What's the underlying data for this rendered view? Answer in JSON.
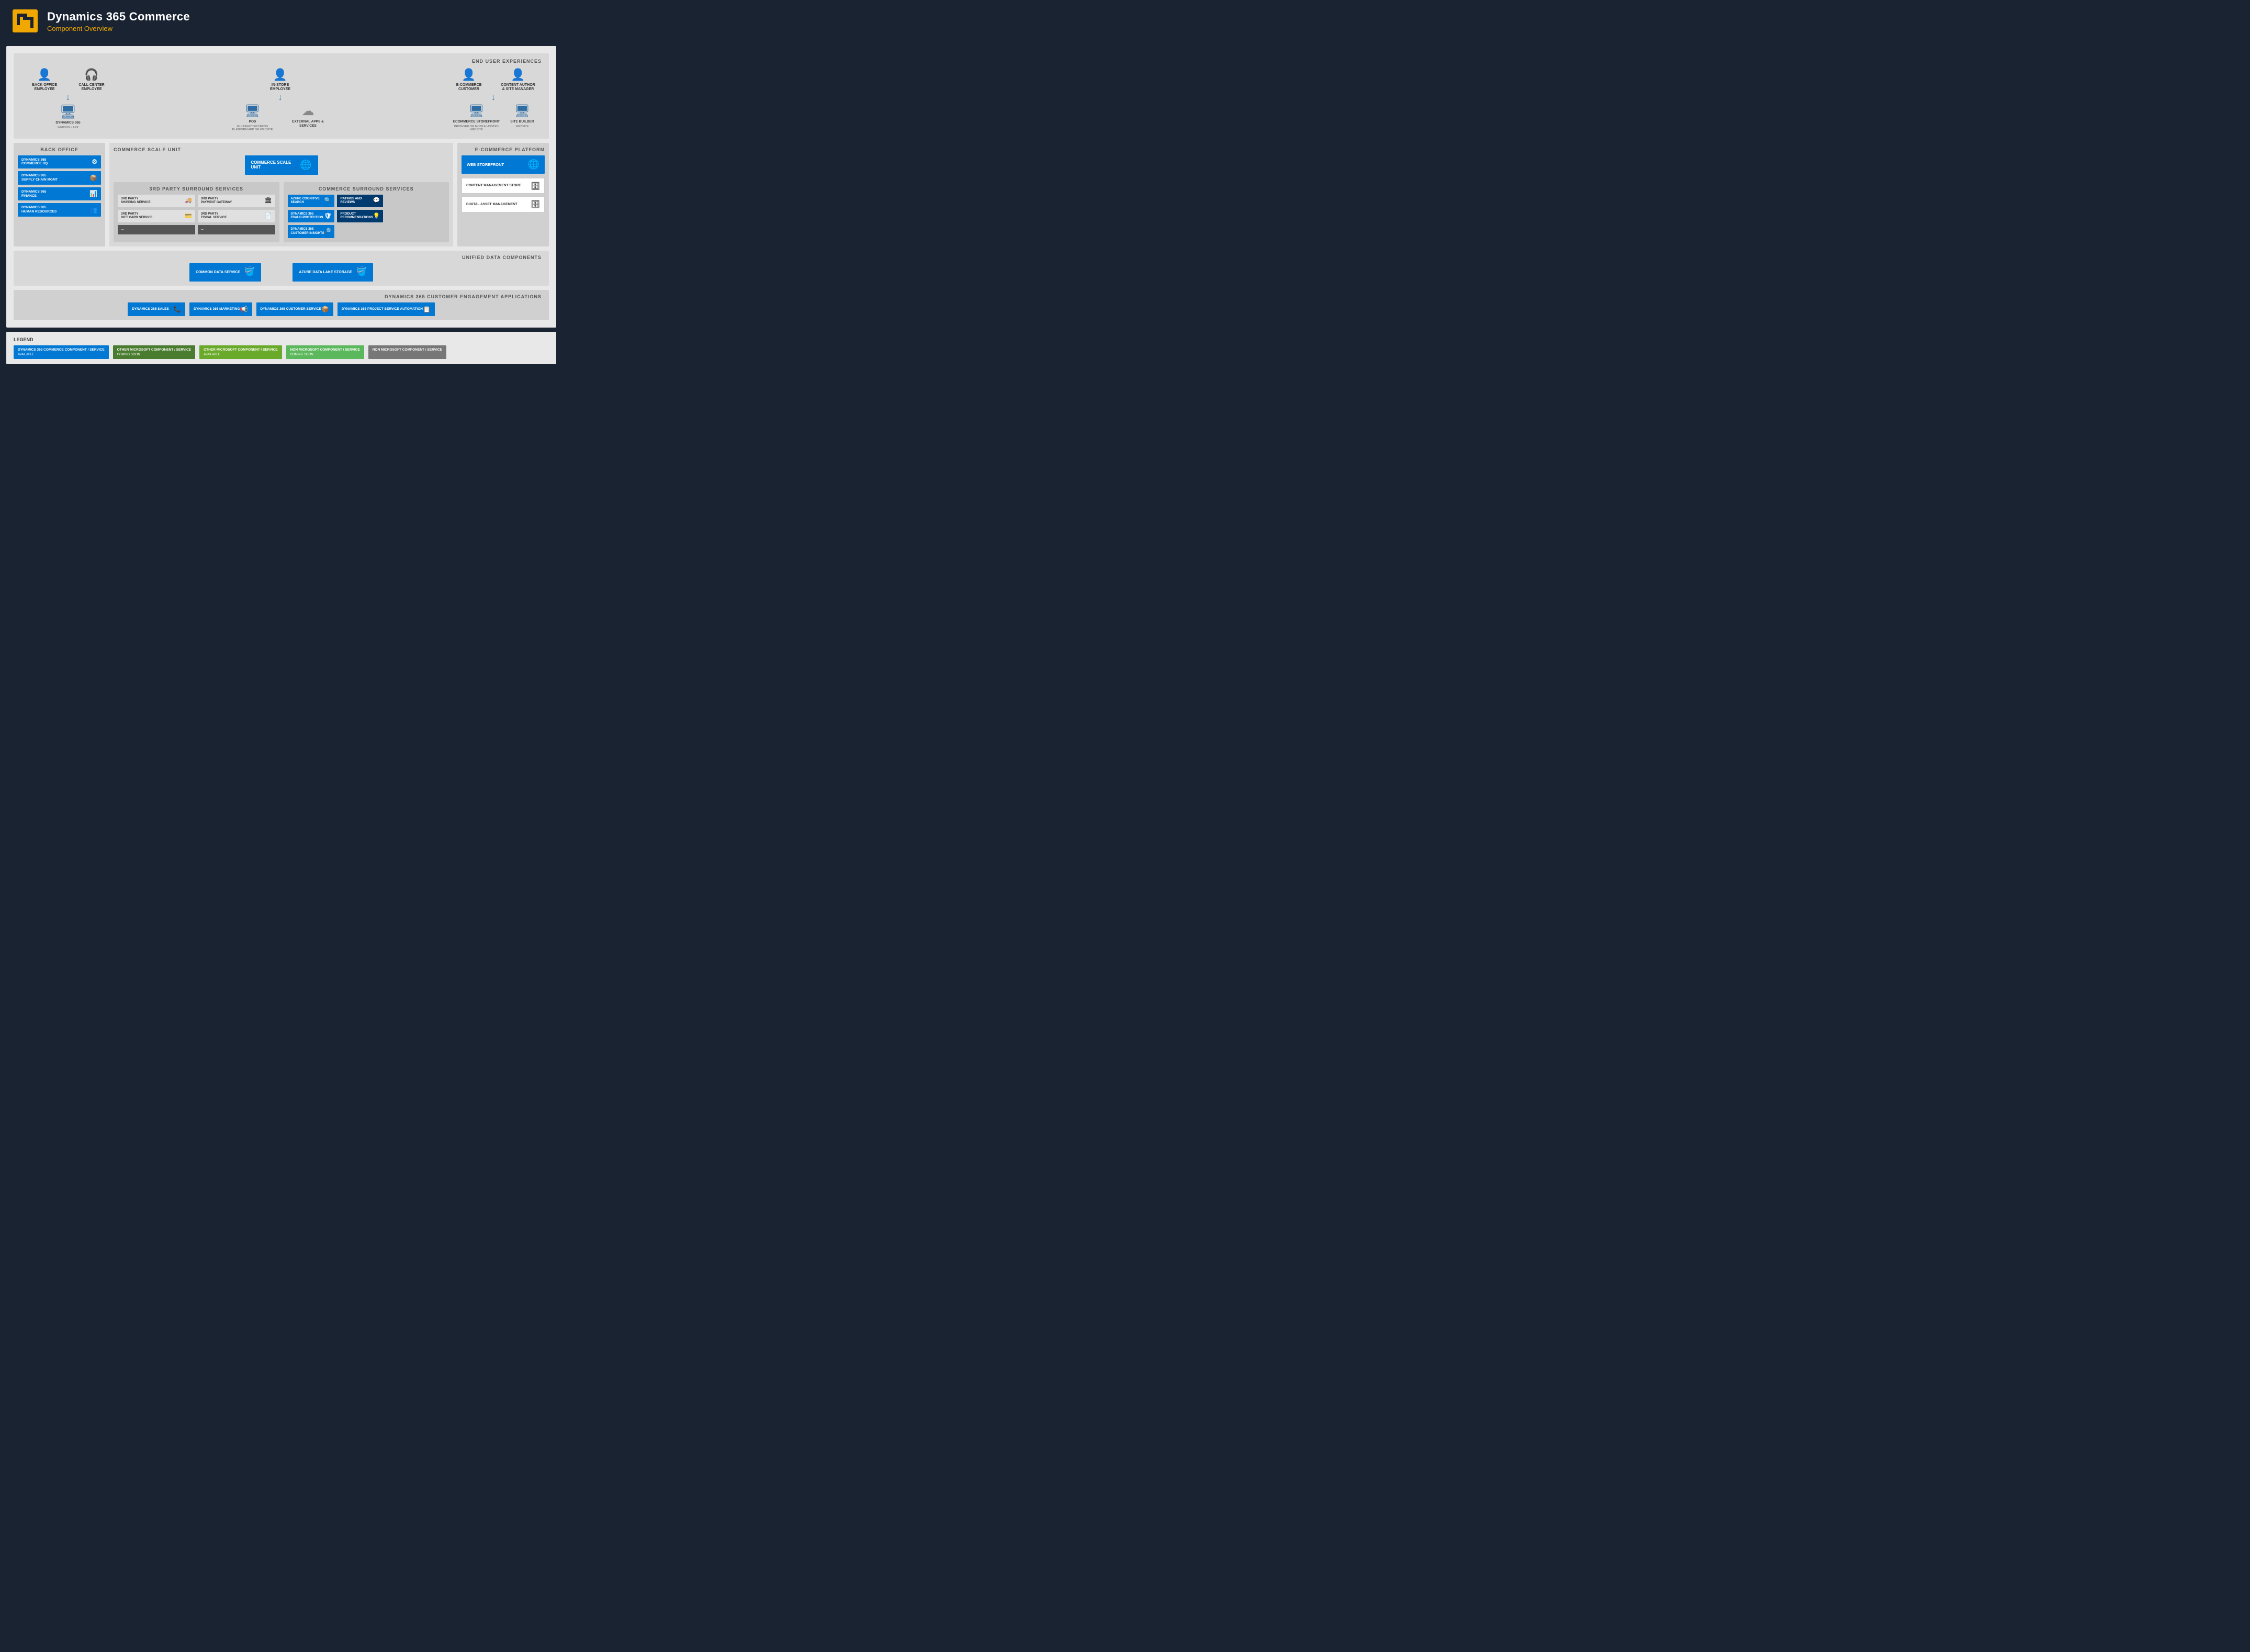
{
  "header": {
    "title": "Dynamics 365 Commerce",
    "subtitle": "Component Overview"
  },
  "endUser": {
    "sectionLabel": "END USER EXPERIENCES",
    "users": [
      {
        "name": "BACK OFFICE EMPLOYEE"
      },
      {
        "name": "CALL CENTER EMPLOYEE"
      },
      {
        "name": "IN-STORE EMPLOYEE"
      },
      {
        "name": "E-COMMERCE CUSTOMER"
      },
      {
        "name": "CONTENT AUTHOR & SITE MANAGER"
      }
    ],
    "devices": [
      {
        "label": "DYNAMICS 365",
        "sublabel": "WEBSITE / APP"
      },
      {
        "label": "POS",
        "sublabel": "MULTIFACTOR/CROSS PLATFORM APP OR WEBSITE"
      },
      {
        "label": "EXTERNAL APPS & SERVICES",
        "sublabel": ""
      },
      {
        "label": "ECOMMERCE STOREFRONT",
        "sublabel": "BROWSER OR MOBILE HOSTED WEBSITE"
      },
      {
        "label": "SITE BUILDER",
        "sublabel": "WEBSITE"
      }
    ]
  },
  "backOffice": {
    "label": "BACK OFFICE",
    "items": [
      {
        "text": "DYNAMICS 365 COMMERCE HQ",
        "icon": "⚙"
      },
      {
        "text": "DYNAMICS 365 SUPPLY CHAIN MGMT",
        "icon": "📦"
      },
      {
        "text": "DYNAMICS 365 FINANCE",
        "icon": "📊"
      },
      {
        "text": "DYNAMICS 365 HUMAN RESOURCES",
        "icon": "👥"
      }
    ]
  },
  "csu": {
    "label": "COMMERCE SCALE UNIT",
    "boxLabel": "COMMERCE SCALE UNIT"
  },
  "thirdParty": {
    "label": "3rd PARTY SURROUND SERVICES",
    "items": [
      {
        "text": "3RD PARTY SHIPPING SERVICE",
        "icon": "🚚"
      },
      {
        "text": "3RD PARTY PAYMENT GATEWAY",
        "icon": "🏛"
      },
      {
        "text": "3RD PARTY GIFT CARD SERVICE",
        "icon": "💳"
      },
      {
        "text": "3RD PARTY FISCAL SERVICE",
        "icon": "📄"
      },
      {
        "text": "...",
        "icon": ""
      },
      {
        "text": "...",
        "icon": ""
      }
    ]
  },
  "commerceSurround": {
    "label": "COMMERCE SURROUND SERVICES",
    "items": [
      {
        "text": "AZURE COGNITIVE SEARCH",
        "icon": "🔍"
      },
      {
        "text": "DYNAMICS 365 FRAUD PROTECTION",
        "icon": "🛡"
      },
      {
        "text": "DYNAMICS 365 CUSTOMER INSIGHTS",
        "icon": "🔎"
      },
      {
        "text": "RATINGS AND REVIEWS",
        "icon": "💬"
      },
      {
        "text": "PRODUCT RECOMMENDATIONS",
        "icon": "💡"
      }
    ]
  },
  "webStorefront": {
    "label": "WEB STOREFRONT"
  },
  "ecommerce": {
    "label": "E-COMMERCE PLATFORM",
    "items": [
      {
        "text": "CONTENT MANAGEMENT STORE",
        "icon": "🗄"
      },
      {
        "text": "DIGITAL ASSET MANAGEMENT",
        "icon": "🗄"
      }
    ]
  },
  "unified": {
    "label": "UNIFIED DATA COMPONENTS",
    "items": [
      {
        "text": "COMMON DATA SERVICE",
        "icon": "🪣"
      },
      {
        "text": "AZURE DATA LAKE STORAGE",
        "icon": "🪣"
      }
    ]
  },
  "engagement": {
    "label": "DYNAMICS 365 CUSTOMER ENGAGEMENT APPLICATIONS",
    "items": [
      {
        "text": "DYNAMICS 365 SALES",
        "icon": "📞"
      },
      {
        "text": "DYNAMICS 365 MARKETING",
        "icon": "📢"
      },
      {
        "text": "DYNAMICS 365 CUSTOMER SERVICE",
        "icon": "📦"
      },
      {
        "text": "DYNAMICS 365 PROJECT SERVICE AUTOMATION",
        "icon": "📋"
      }
    ]
  },
  "legend": {
    "title": "LEGEND",
    "items": [
      {
        "title": "DYNAMICS 365 COMMERCE COMPONENT / SERVICE",
        "sub": "AVAILABLE",
        "class": "leg-blue"
      },
      {
        "title": "OTHER MICROSOFT COMPONENT / SERVICE",
        "sub": "COMING SOON",
        "class": "leg-green-dark"
      },
      {
        "title": "OTHER MICROSOFT COMPONENT / SERVICE",
        "sub": "AVAILABLE",
        "class": "leg-green-light"
      },
      {
        "title": "NON MICROSOFT COMPONENT / SERVICE",
        "sub": "COMING SOON",
        "class": "leg-green-bright"
      },
      {
        "title": "NON MICROSOFT COMPONENT / SERVICE",
        "sub": "",
        "class": "leg-gray"
      }
    ]
  },
  "availableLabel": "AVAILABLE"
}
